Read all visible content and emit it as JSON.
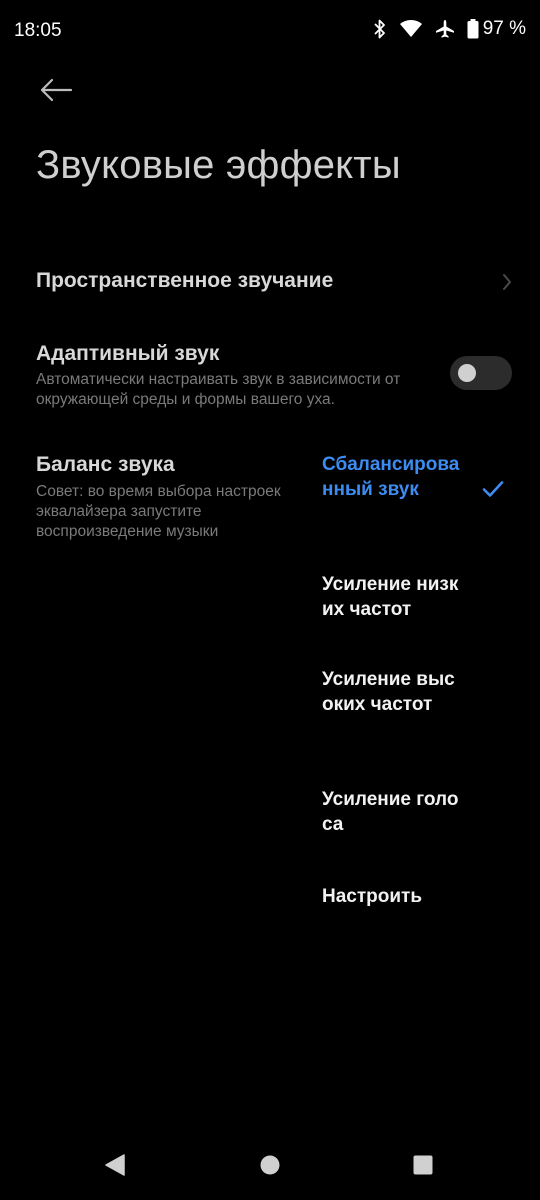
{
  "status_bar": {
    "time": "18:05",
    "battery": "97 %",
    "icons": [
      "bluetooth-icon",
      "wifi-icon",
      "airplane-icon",
      "battery-icon"
    ]
  },
  "header": {
    "back_icon": "arrow-left-icon",
    "title": "Звуковые эффекты"
  },
  "settings": {
    "spatial": {
      "title": "Пространственное звучание",
      "icon": "chevron-right-icon"
    },
    "adaptive": {
      "title": "Адаптивный звук",
      "subtitle": "Автоматически настраивать звук в зависимости от окружающей среды и формы вашего уха.",
      "enabled": false
    },
    "balance": {
      "title": "Баланс звука",
      "subtitle": "Совет: во время выбора настроек эквалайзера запустите воспроизведение музыки",
      "options": [
        {
          "label": "Сбалансированный звук",
          "selected": true
        },
        {
          "label": "Усиление низких частот",
          "selected": false
        },
        {
          "label": "Усиление высоких частот",
          "selected": false
        },
        {
          "label": "Усиление голоса",
          "selected": false
        },
        {
          "label": "Настроить",
          "selected": false
        }
      ]
    }
  },
  "nav_bar": {
    "icons": [
      "back-triangle-icon",
      "home-circle-icon",
      "recents-square-icon"
    ]
  },
  "colors": {
    "background": "#000000",
    "accent": "#3c8cf2",
    "secondary_text": "#7a7a7a"
  }
}
